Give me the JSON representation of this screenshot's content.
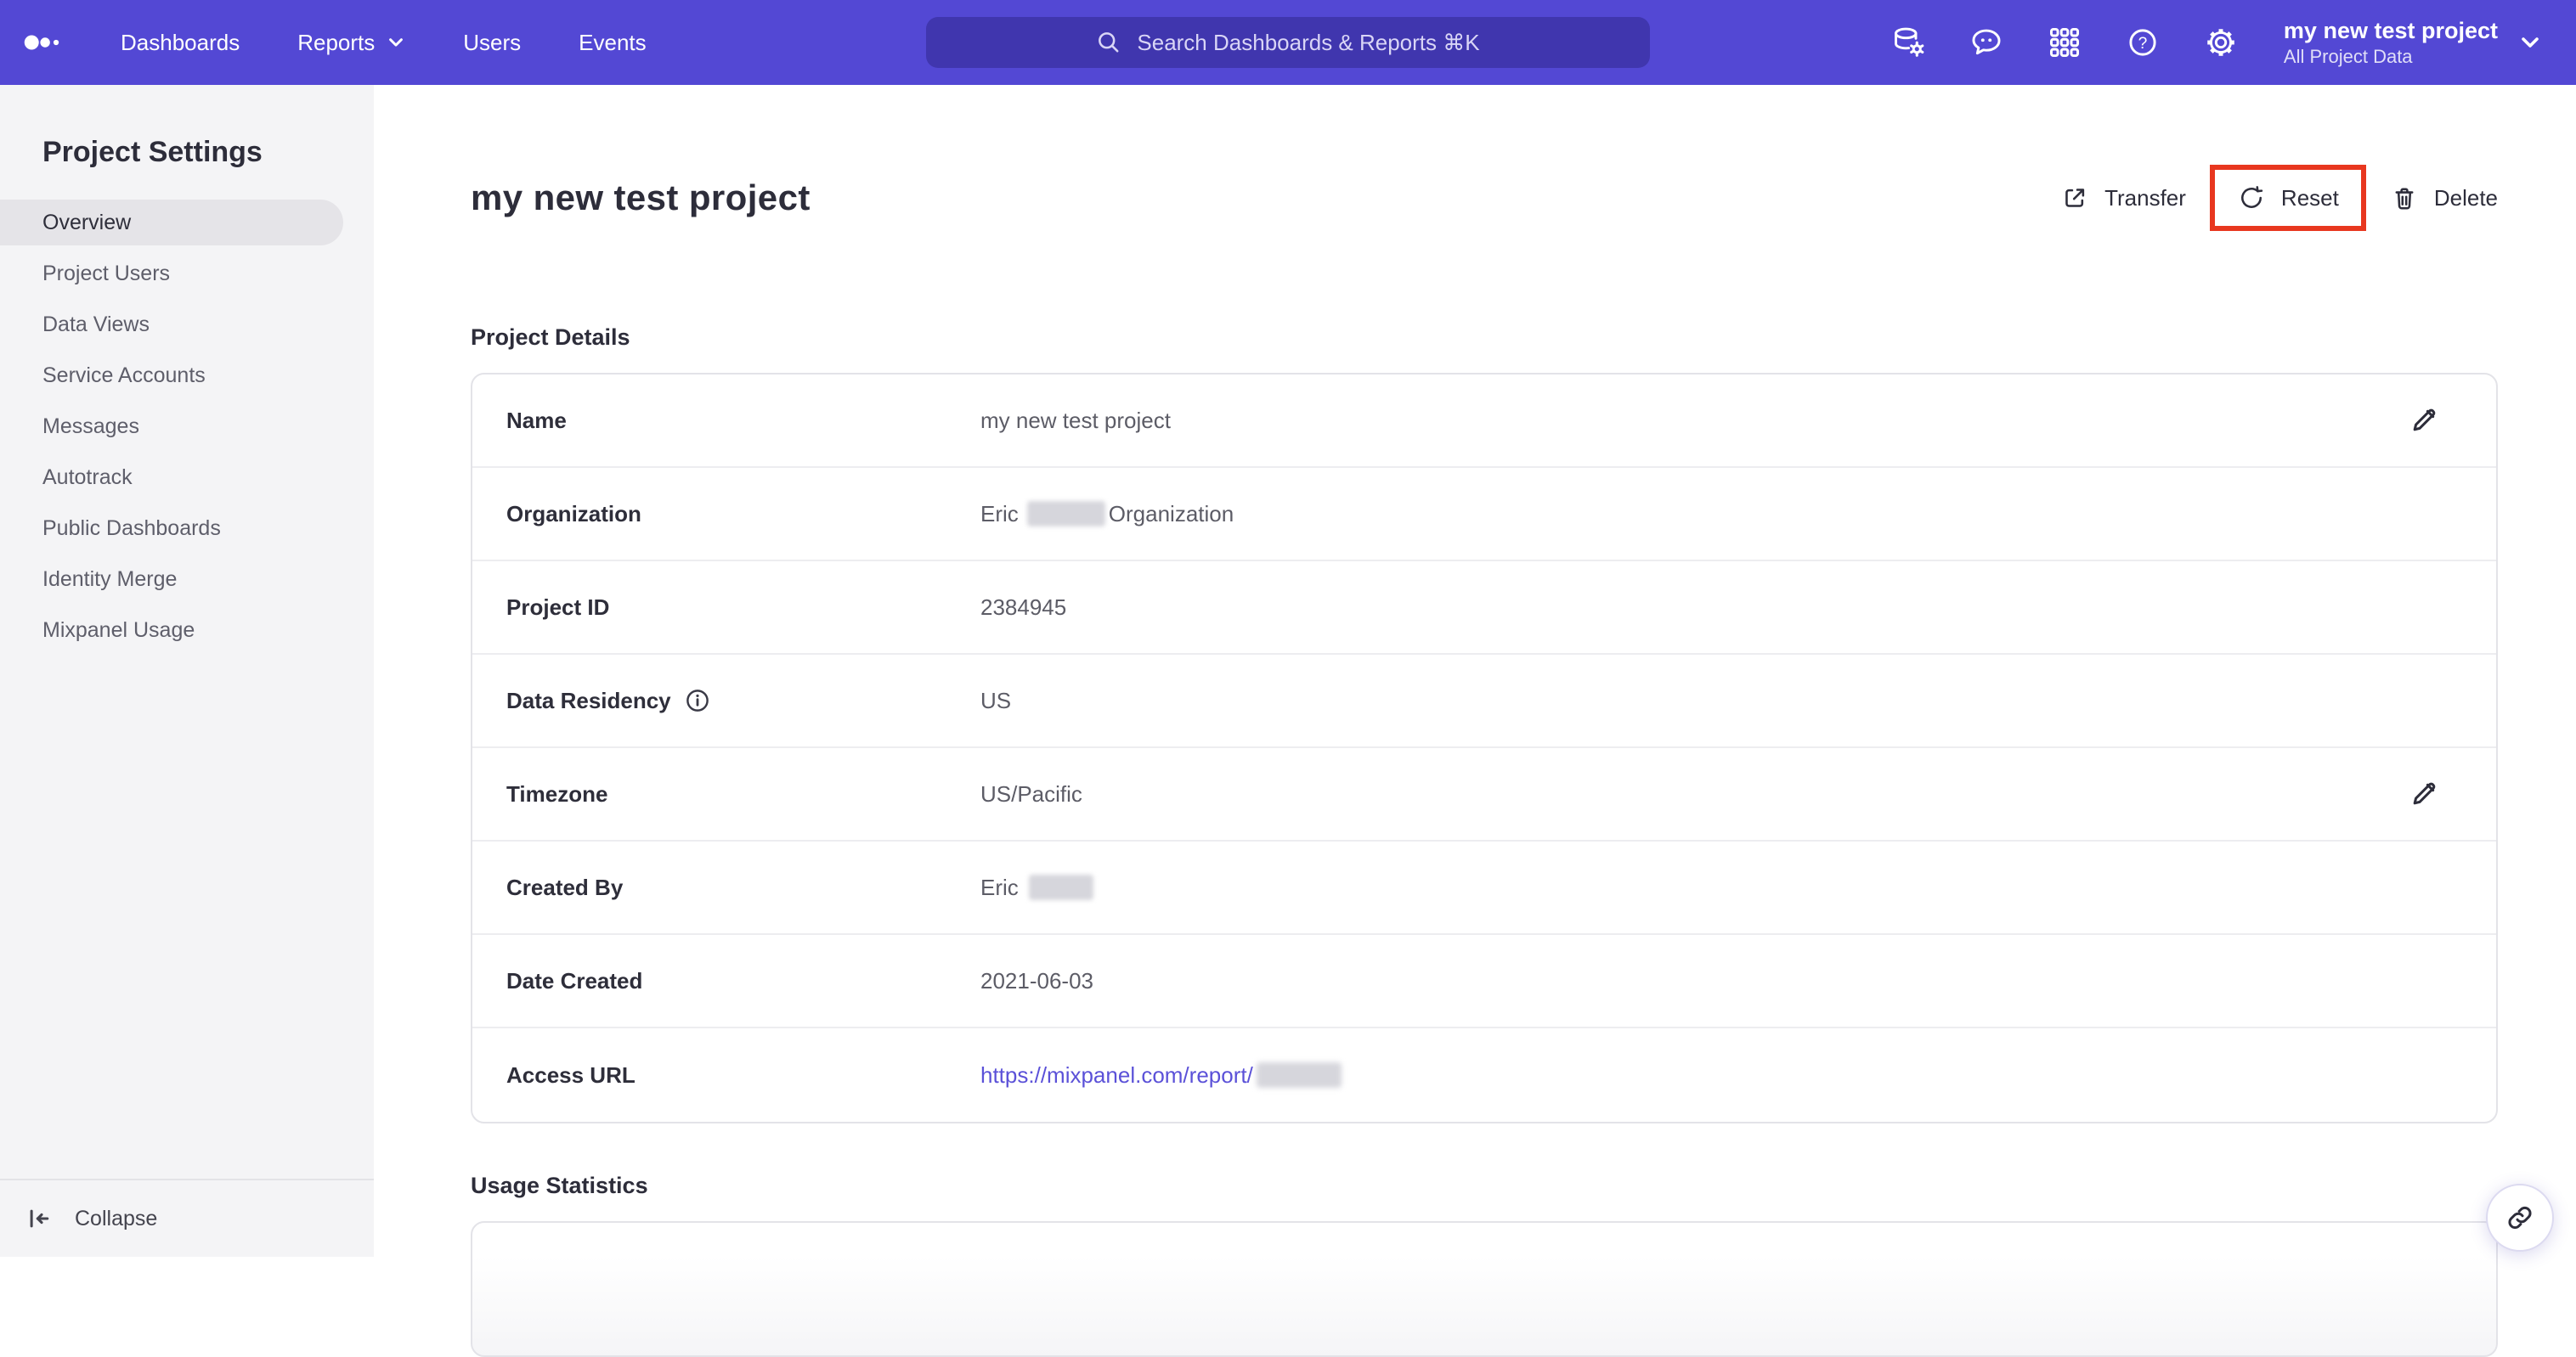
{
  "nav": {
    "items": [
      {
        "label": "Dashboards"
      },
      {
        "label": "Reports"
      },
      {
        "label": "Users"
      },
      {
        "label": "Events"
      }
    ],
    "search_placeholder": "Search Dashboards & Reports ⌘K",
    "project": {
      "name": "my new test project",
      "scope": "All Project Data"
    }
  },
  "sidebar": {
    "title": "Project Settings",
    "items": [
      {
        "label": "Overview",
        "active": true
      },
      {
        "label": "Project Users"
      },
      {
        "label": "Data Views"
      },
      {
        "label": "Service Accounts"
      },
      {
        "label": "Messages"
      },
      {
        "label": "Autotrack"
      },
      {
        "label": "Public Dashboards"
      },
      {
        "label": "Identity Merge"
      },
      {
        "label": "Mixpanel Usage"
      }
    ],
    "collapse_label": "Collapse"
  },
  "page": {
    "title": "my new test project",
    "actions": {
      "transfer": "Transfer",
      "reset": "Reset",
      "delete": "Delete"
    }
  },
  "details": {
    "heading": "Project Details",
    "rows": [
      {
        "label": "Name",
        "value": "my new test project"
      },
      {
        "label": "Organization",
        "value": "Eric",
        "value_suffix": "Organization"
      },
      {
        "label": "Project ID",
        "value": "2384945"
      },
      {
        "label": "Data Residency",
        "value": "US"
      },
      {
        "label": "Timezone",
        "value": "US/Pacific"
      },
      {
        "label": "Created By",
        "value": "Eric"
      },
      {
        "label": "Date Created",
        "value": "2021-06-03"
      },
      {
        "label": "Access URL",
        "value": "https://mixpanel.com/report/"
      }
    ]
  },
  "usage": {
    "heading": "Usage Statistics"
  },
  "colors": {
    "navbar": "#5348d4",
    "search_field": "#4740b5",
    "annotation_red": "#e8371f",
    "link": "#5b51d8",
    "sidebar_bg": "#f4f4f6",
    "active_item_bg": "#e5e4e8"
  }
}
